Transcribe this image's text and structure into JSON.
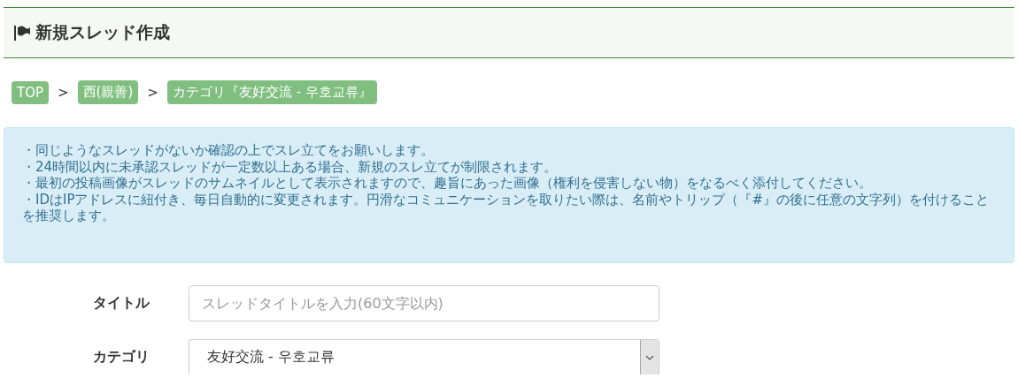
{
  "page_header": {
    "title": "新規スレッド作成"
  },
  "breadcrumbs": [
    {
      "label": "TOP"
    },
    {
      "label": "西(親善)"
    },
    {
      "label": "カテゴリ『友好交流 - 우호교류』"
    }
  ],
  "breadcrumb_separator": ">",
  "notice": [
    "・同じようなスレッドがないか確認の上でスレ立てをお願いします。",
    "・24時間以内に未承認スレッドが一定数以上ある場合、新規のスレ立てが制限されます。",
    "・最初の投稿画像がスレッドのサムネイルとして表示されますので、趣旨にあった画像（権利を侵害しない物）をなるべく添付してください。",
    "・IDはIPアドレスに紐付き、毎日自動的に変更されます。円滑なコミュニケーションを取りたい際は、名前やトリップ（『#』の後に任意の文字列）を付けることを推奨します。"
  ],
  "form": [
    {
      "kind": "text",
      "label": "タイトル",
      "placeholder": "スレッドタイトルを入力(60文字以内)"
    },
    {
      "kind": "select",
      "label": "カテゴリ",
      "value": "友好交流 - 우호교류"
    }
  ]
}
